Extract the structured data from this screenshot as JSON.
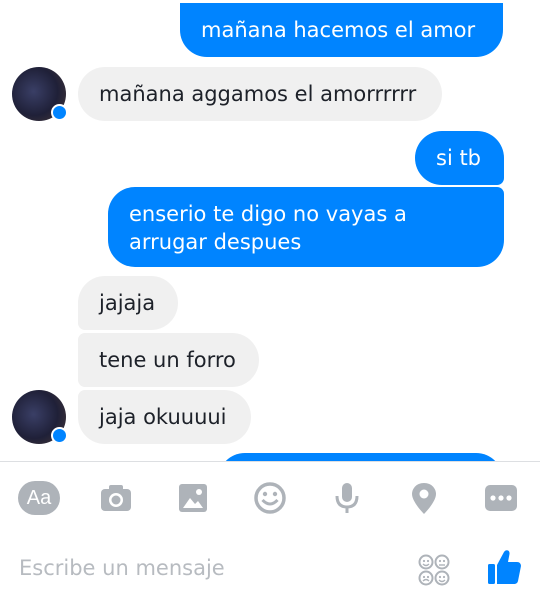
{
  "messages": [
    {
      "sender": "me",
      "text": "mañana hacemos el amor"
    },
    {
      "sender": "contact",
      "text": "mañana aggamos el amorrrrrr"
    },
    {
      "sender": "me",
      "text": "si tb"
    },
    {
      "sender": "me",
      "lines": [
        "enserio te digo no vayas a",
        "arrugar despues"
      ]
    },
    {
      "sender": "contact",
      "text": "jajaja"
    },
    {
      "sender": "contact",
      "text": "tene un forro"
    },
    {
      "sender": "contact",
      "text": "jaja okuuuui"
    }
  ],
  "toolbar": {
    "text_style_label": "Aa",
    "icons": [
      "text-style-icon",
      "camera-icon",
      "image-icon",
      "emoji-icon",
      "microphone-icon",
      "location-icon",
      "more-icon"
    ]
  },
  "composer": {
    "placeholder": "Escribe un mensaje",
    "stickers_icon": "stickers-icon",
    "like_icon": "thumbs-up-icon"
  },
  "colors": {
    "outgoing_bubble": "#0084ff",
    "incoming_bubble": "#f0f0f0",
    "icon_gray": "#aeb3b9",
    "accent": "#0084ff"
  }
}
